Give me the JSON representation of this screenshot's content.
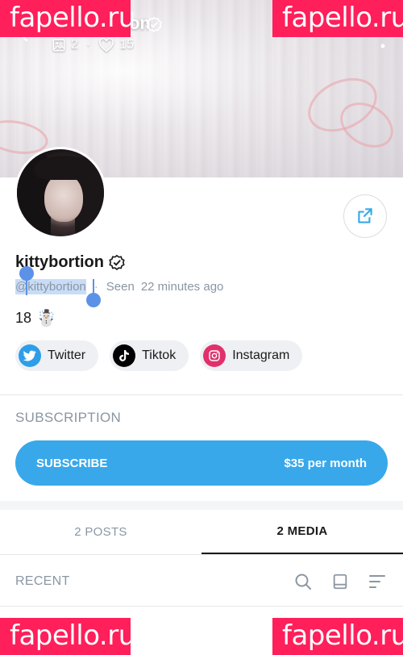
{
  "header": {
    "title": "kittybortion",
    "stats": {
      "photos": "2",
      "likes": "15"
    },
    "cover_image": "curtains-cover"
  },
  "watermarks": [
    "fapello.ru",
    "fapello.ru",
    "fapello.ru",
    "fapello.ru"
  ],
  "profile": {
    "name": "kittybortion",
    "handle": "@kittybortion",
    "seen_prefix": "Seen",
    "seen_time": "22 minutes ago",
    "bio_text": "18",
    "bio_emoji": "☃️",
    "avatar": "profile-avatar"
  },
  "socials": [
    {
      "label": "Twitter",
      "icon": "twitter-icon",
      "color": "#2f9ee8"
    },
    {
      "label": "Tiktok",
      "icon": "tiktok-icon",
      "color": "#000000"
    },
    {
      "label": "Instagram",
      "icon": "instagram-icon",
      "color": "#e1306c"
    }
  ],
  "subscription": {
    "section_title": "SUBSCRIPTION",
    "button_label": "SUBSCRIBE",
    "price": "$35 per month",
    "accent": "#38a8ea"
  },
  "tabs": [
    {
      "label": "2 POSTS",
      "active": false
    },
    {
      "label": "2 MEDIA",
      "active": true
    }
  ],
  "feed": {
    "label": "RECENT",
    "tools": [
      "search-icon",
      "grid-view-icon",
      "sort-icon"
    ]
  }
}
